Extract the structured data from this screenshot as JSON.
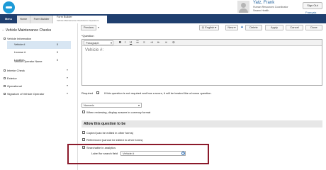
{
  "header": {
    "user_name": "Yatz, Frank",
    "user_role": "Human Resources Coordinator",
    "user_org": "Swann Health",
    "signout_label": "Sign Out",
    "language_label": "Français"
  },
  "tabs": {
    "menu": "Menu",
    "home": "Home",
    "form_builder": "Form Builder",
    "active_title": "Form Builder",
    "active_subtitle": "Vehicle Maintenance Checklist for Operators"
  },
  "left": {
    "preview_label": "Preview",
    "tree_title": "Vehicle Maintenance Checks",
    "sections": [
      {
        "label": "Vehicle Information"
      },
      {
        "label": "Interior Check"
      },
      {
        "label": "Exterior"
      },
      {
        "label": "Operational"
      },
      {
        "label": "Signature of Vehicle Operator"
      }
    ],
    "items": [
      {
        "label": "Vehicle #",
        "num": "0"
      },
      {
        "label": "License #",
        "num": "0"
      },
      {
        "label": "Location",
        "num": "0"
      },
      {
        "label": "Vehicle Operator Name",
        "num": "0"
      }
    ]
  },
  "toolbar": {
    "language": "English",
    "new": "New",
    "delete": "Delete",
    "apply": "Apply",
    "cancel": "Cancel",
    "done": "Done"
  },
  "question": {
    "label": "*Question",
    "paragraph_select": "Paragraph",
    "body_text": "Vehicle #:",
    "required_label": "Required",
    "required_note": "If this question is not required and has a score, it will be treated like a bonus question.",
    "answer_type": "Numeric",
    "currency_label": "When reviewing, display answer in currency format"
  },
  "allow": {
    "header": "Allow this question to be",
    "copied_label": "Copied (can be edited in other forms)",
    "referenced_label": "Referenced (cannot be edited in other forms)",
    "searchable_label": "Searchable in analytics",
    "search_field_label": "Label for search field",
    "search_field_value": "Vehicle #"
  },
  "colors": {
    "tabbar": "#1f3f6f",
    "accent_blue": "#1e9bd7",
    "highlight_box": "#8b1a2b"
  }
}
